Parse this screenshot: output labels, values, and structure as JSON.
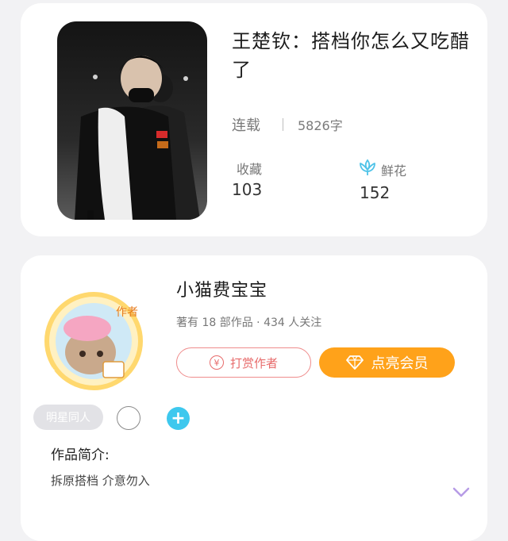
{
  "book": {
    "title": "王楚钦：搭档你怎么又吃醋了",
    "status": "连载",
    "word_count": "5826字",
    "favorites_label": "收藏",
    "favorites_count": "103",
    "flowers_label": "鲜花",
    "flowers_count": "152",
    "cover_icon": "book-cover-photo"
  },
  "author": {
    "name": "小猫费宝宝",
    "meta": "著有 18 部作品 · 434 人关注",
    "avatar_badge": "作者",
    "reward_label": "打赏作者",
    "vip_label": "点亮会员",
    "tag": "明星同人",
    "plus_label": "+",
    "intro_title": "作品简介:",
    "intro_text": "拆原搭档 介意勿入"
  },
  "icons": {
    "flower": "lotus-flower-icon",
    "reward": "yen-coin-icon",
    "vip": "diamond-icon",
    "expand": "chevron-down-icon"
  },
  "colors": {
    "background": "#f2f2f4",
    "card": "#ffffff",
    "reward_accent": "#e76b6b",
    "vip_orange": "#ffa21a",
    "plus_blue": "#3ec8ee",
    "flower_blue": "#4fc3e8",
    "chevron_purple": "#b69be6"
  }
}
